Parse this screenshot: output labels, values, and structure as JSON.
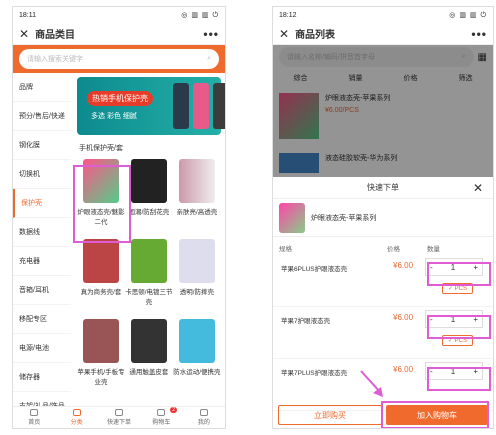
{
  "left": {
    "status": {
      "time": "18:11",
      "icons": "◎ ▥ ▥ ⏻"
    },
    "header": {
      "close": "✕",
      "title": "商品类目",
      "more": "•••"
    },
    "search": {
      "placeholder": "请输入搜索关键字"
    },
    "categories": [
      "品牌",
      "预分/售后/快递",
      "钢化膜",
      "切换机",
      "保护壳",
      "数据线",
      "充电器",
      "音箱/耳机",
      "移配专区",
      "电源/电池",
      "储存器",
      "支架/礼品/饰品"
    ],
    "active_category": "保护壳",
    "banner": {
      "title": "热销手机保护壳",
      "sub": "多选 彩色 细腻"
    },
    "section": "手机保护壳/套",
    "products": [
      "炉眼液态壳/魅影二代",
      "国潮/防刮花壳",
      "亲肤亮/高透壳",
      "真为商务壳/套",
      "卡思顿/电镀三节壳",
      "透明/防摔壳",
      "苹果手机/手板专业壳",
      "通用触盖皮套",
      "防水运动/便携壳"
    ],
    "tabs": [
      "首页",
      "分类",
      "快速下单",
      "购物车",
      "我的"
    ],
    "cart_badge": "2"
  },
  "right": {
    "status": {
      "time": "18:12",
      "icons": "◎ ▥ ▥ ⏻"
    },
    "header": {
      "close": "✕",
      "title": "商品列表",
      "more": "•••"
    },
    "search": {
      "placeholder": "请输入名称/编码/拼音首字母"
    },
    "sort": [
      "综合",
      "销量",
      "价格",
      "筛选"
    ],
    "list_title_1": "炉眼液态壳-苹果系列",
    "list_price_1": "¥6.00",
    "list_unit_1": "/PCS",
    "list_title_2": "液态硅胶软壳-华为系列",
    "sheet": {
      "title": "快速下单",
      "close": "✕",
      "product": "炉眼液态壳-苹果系列",
      "col_spec": "规格",
      "col_price": "价格",
      "col_qty": "数量"
    },
    "rows": [
      {
        "name": "苹果6PLUS护眼液态壳",
        "price": "¥6.00",
        "qty": "1",
        "unit": "PCS"
      },
      {
        "name": "苹果7护眼液态壳",
        "price": "¥6.00",
        "qty": "1",
        "unit": "PCS"
      },
      {
        "name": "苹果7PLUS护眼液态壳",
        "price": "¥6.00",
        "qty": "1",
        "unit": "PCS"
      }
    ],
    "buy_label": "立即购买",
    "cart_label": "加入购物车"
  },
  "colors": {
    "accent": "#f06a2e",
    "highlight": "#e05cd4"
  }
}
